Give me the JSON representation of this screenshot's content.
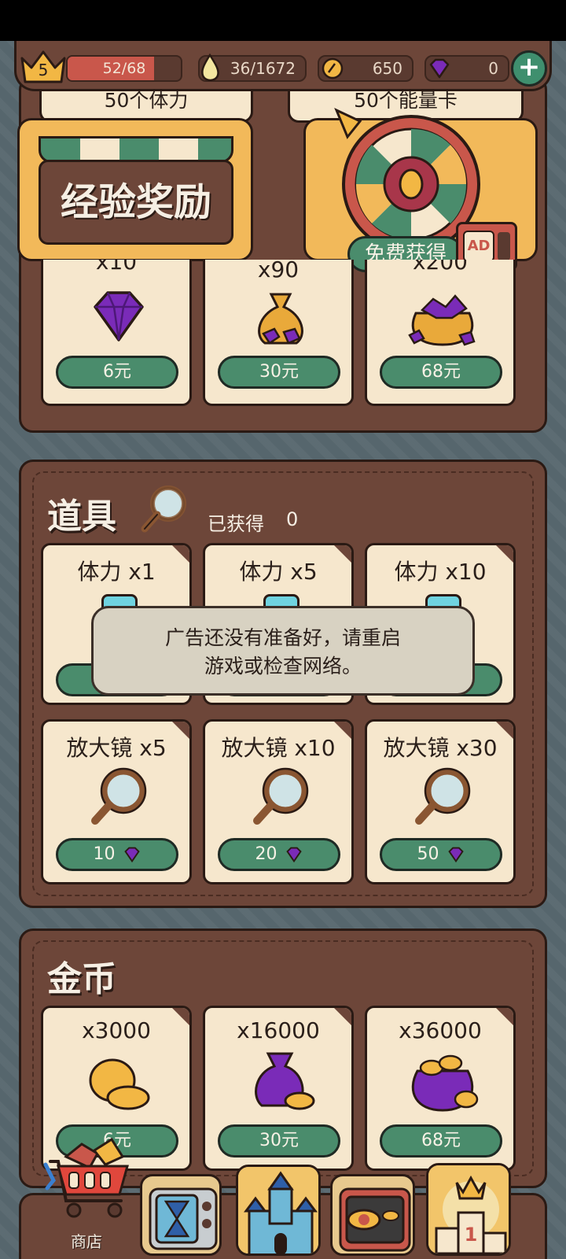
{
  "resources": {
    "level": "5",
    "xp_text": "52/68",
    "xp_progress": 0.765,
    "stamina_text": "36/1672",
    "coins_text": "650",
    "gems_text": "0"
  },
  "promo": {
    "stamina_card": "50个体力",
    "energy_card": "50个能量卡",
    "exp_reward": "经验奖励",
    "free_get": "免费获得",
    "ad_label": "AD"
  },
  "gems_section": {
    "items": [
      {
        "qty": "x10",
        "price": "6元"
      },
      {
        "qty": "x90",
        "price": "30元"
      },
      {
        "qty": "x200",
        "price": "68元"
      }
    ]
  },
  "props_section": {
    "title": "道具",
    "obtained_label": "已获得",
    "obtained_count": "0",
    "stamina_items": [
      {
        "qty": "体力 x1"
      },
      {
        "qty": "体力 x5"
      },
      {
        "qty": "体力 x10"
      }
    ],
    "magnifier_items": [
      {
        "qty": "放大镜 x5",
        "price": "10"
      },
      {
        "qty": "放大镜 x10",
        "price": "20"
      },
      {
        "qty": "放大镜 x30",
        "price": "50"
      }
    ]
  },
  "toast": {
    "line1": "广告还没有准备好，请重启",
    "line2": "游戏或检查网络。"
  },
  "coins_section": {
    "title": "金币",
    "items": [
      {
        "qty": "x3000",
        "price": "6元"
      },
      {
        "qty": "x16000",
        "price": "30元"
      },
      {
        "qty": "x36000",
        "price": "68元"
      }
    ]
  },
  "bottom_nav": {
    "shop_label": "商店"
  },
  "colors": {
    "panel": "#6d4639",
    "card": "#f6e7cd",
    "button_green": "#4a8c6c",
    "gem_purple": "#7a2bb8",
    "xp_red": "#c9574b"
  }
}
